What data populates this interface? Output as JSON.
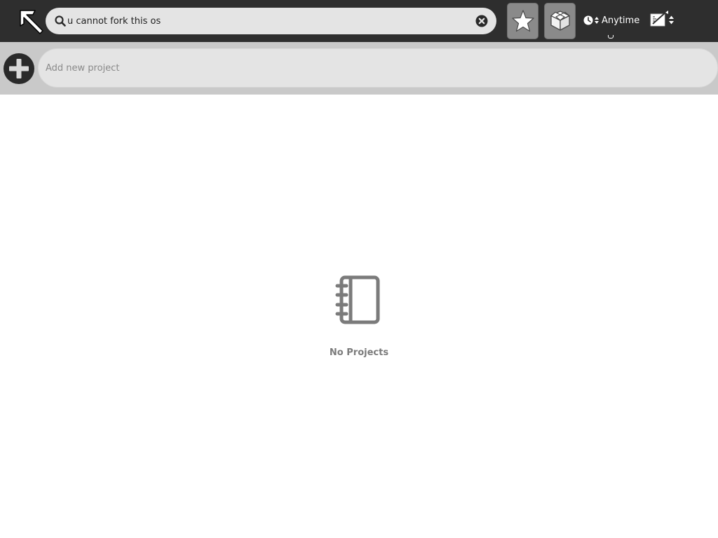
{
  "toolbar": {
    "logo_icon": "arrow-up-left-logo-icon",
    "search": {
      "value": "u cannot fork this os",
      "icon": "search-icon",
      "clear_icon": "clear-icon"
    },
    "starred_icon": "star-icon",
    "projects_icon": "box-icon",
    "time_filter": {
      "label": "Anytime",
      "icon": "clock-icon"
    },
    "sort_icon": "sort-icon"
  },
  "add_project": {
    "icon": "plus-icon",
    "placeholder": "Add new project",
    "value": ""
  },
  "empty_state": {
    "icon": "notebook-icon",
    "label": "No Projects"
  },
  "colors": {
    "toolbar_bg": "#2e2e2e",
    "addbar_bg": "#c9c9c9",
    "field_bg": "#e4e4e4",
    "muted_text": "#7b7b7b"
  }
}
